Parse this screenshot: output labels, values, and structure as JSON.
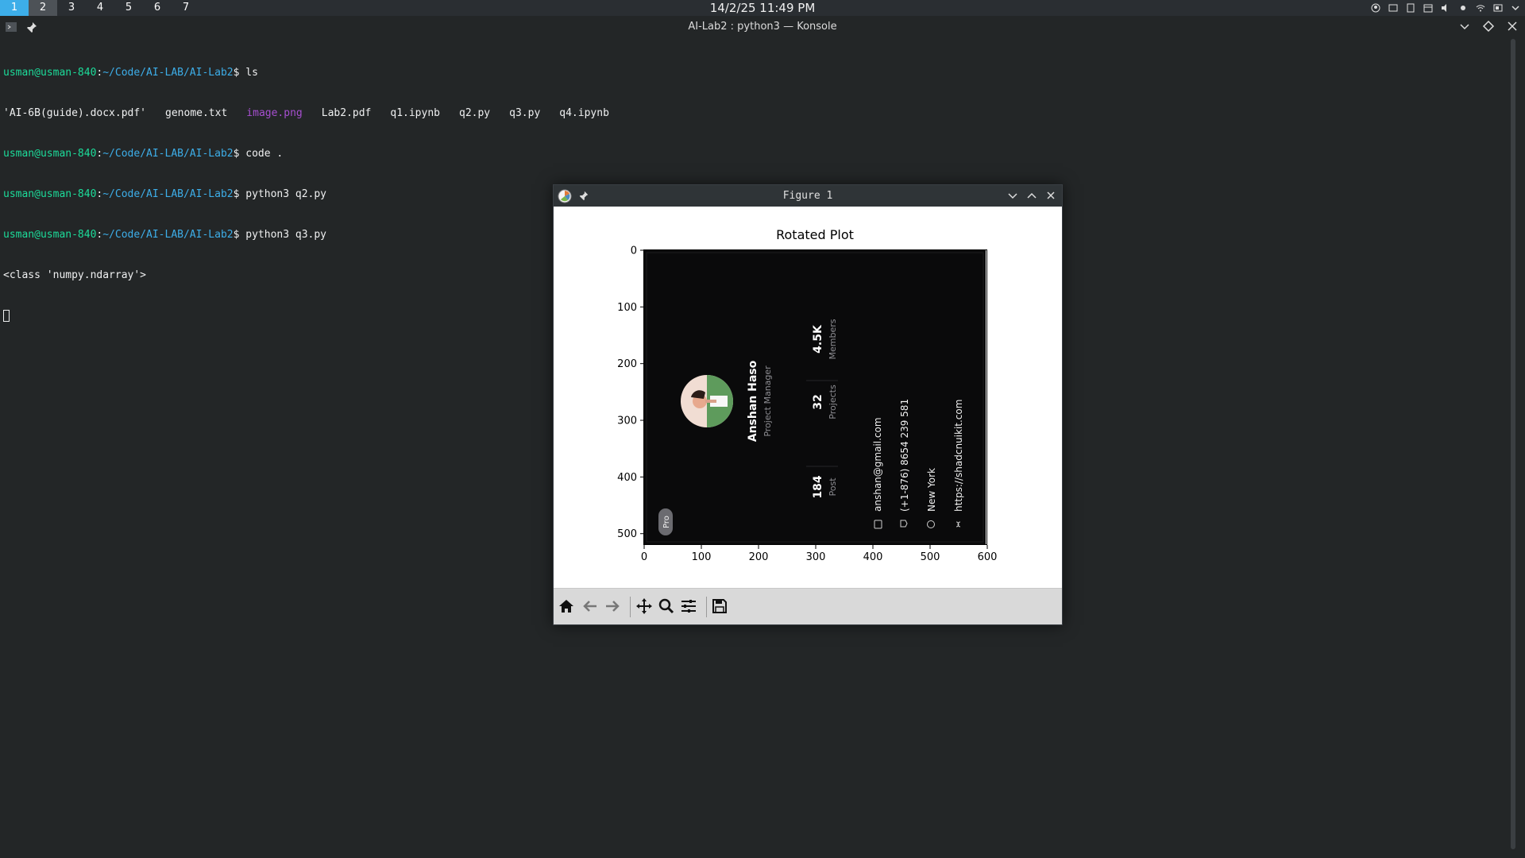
{
  "topbar": {
    "workspaces": [
      "1",
      "2",
      "3",
      "4",
      "5",
      "6",
      "7"
    ],
    "clock": "14/2/25 11:49 PM"
  },
  "konsole": {
    "title": "AI-Lab2 : python3 — Konsole",
    "prompt_user": "usman@usman-840",
    "prompt_path": "~/Code/AI-LAB/AI-Lab2",
    "lines": [
      {
        "type": "prompt",
        "cmd": "ls"
      },
      {
        "type": "ls",
        "items": [
          "'AI-6B(guide).docx.pdf'",
          "genome.txt",
          "image.png",
          "Lab2.pdf",
          "q1.ipynb",
          "q2.py",
          "q3.py",
          "q4.ipynb"
        ]
      },
      {
        "type": "prompt",
        "cmd": "code ."
      },
      {
        "type": "prompt",
        "cmd": "python3 q2.py"
      },
      {
        "type": "prompt",
        "cmd": "python3 q3.py"
      },
      {
        "type": "out",
        "text": "<class 'numpy.ndarray'>"
      }
    ]
  },
  "figure": {
    "window_title": "Figure 1",
    "plot_title": "Rotated Plot",
    "image_texts": {
      "name": "Anshan Haso",
      "role": "Project Manager",
      "stat1_value": "4.5K",
      "stat1_label": "Members",
      "stat2_value": "32",
      "stat2_label": "Projects",
      "stat3_value": "184",
      "stat3_label": "Post",
      "email": "anshan@gmail.com",
      "phone": "(+1-876) 8654 239 581",
      "city": "New York",
      "url": "https://shadcnuikit.com",
      "badge": "Pro"
    },
    "toolbar": [
      "home-icon",
      "back-icon",
      "forward-icon",
      "pan-icon",
      "zoom-icon",
      "configure-icon",
      "save-icon"
    ]
  },
  "chart_data": {
    "type": "image",
    "title": "Rotated Plot",
    "xlim": [
      0,
      600
    ],
    "ylim": [
      520,
      0
    ],
    "xticks": [
      0,
      100,
      200,
      300,
      400,
      500,
      600
    ],
    "yticks": [
      0,
      100,
      200,
      300,
      400,
      500
    ]
  }
}
